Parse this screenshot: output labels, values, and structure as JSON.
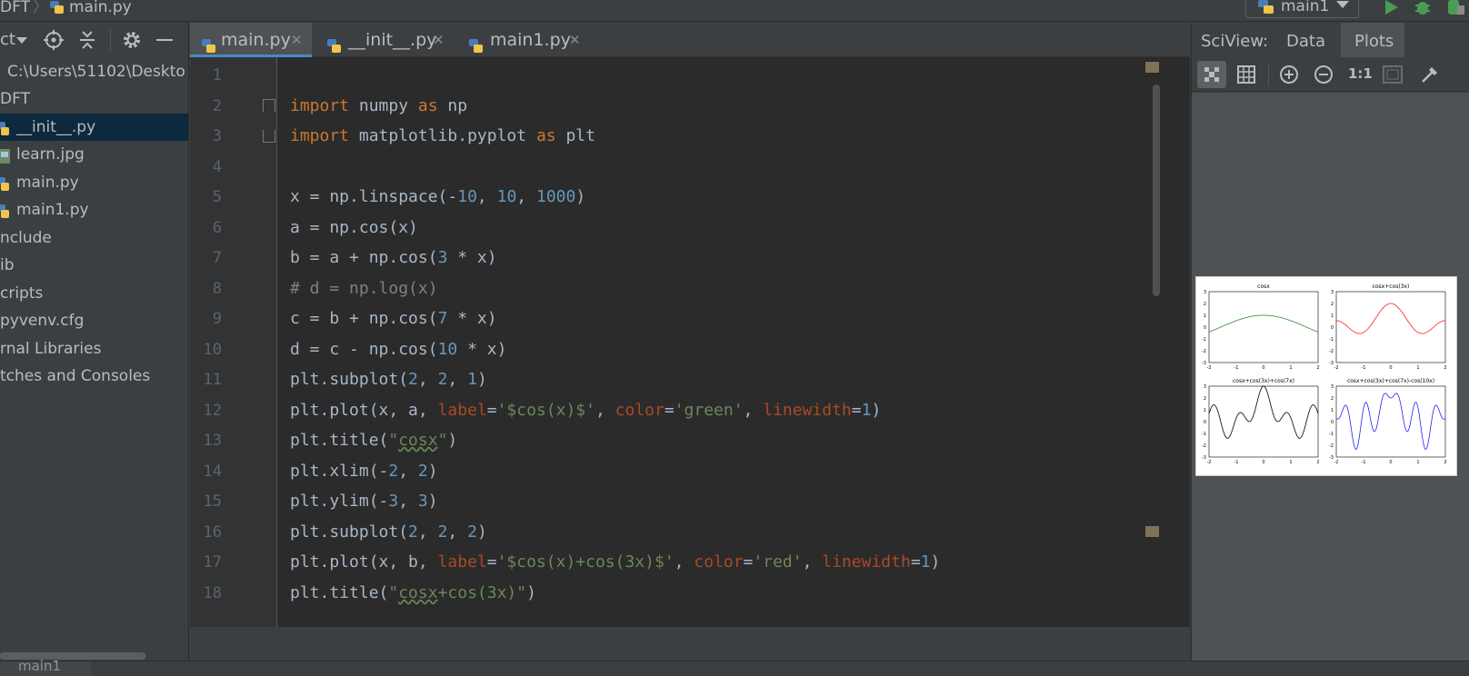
{
  "breadcrumb": {
    "project": "DFT",
    "file": "main.py"
  },
  "run_config": {
    "name": "main1"
  },
  "project_panel": {
    "header_label": "ct",
    "path": "C:\\Users\\51102\\Deskto",
    "items": [
      {
        "label": "DFT"
      },
      {
        "label": "__init__.py"
      },
      {
        "label": "learn.jpg"
      },
      {
        "label": "main.py"
      },
      {
        "label": "main1.py"
      },
      {
        "label": "nclude"
      },
      {
        "label": "ib"
      },
      {
        "label": "cripts"
      },
      {
        "label": "pyvenv.cfg"
      },
      {
        "label": "rnal Libraries"
      },
      {
        "label": "tches and Consoles"
      }
    ]
  },
  "tabs": [
    {
      "label": "main.py"
    },
    {
      "label": "__init__.py"
    },
    {
      "label": "main1.py"
    }
  ],
  "line_numbers": [
    "1",
    "2",
    "3",
    "4",
    "5",
    "6",
    "7",
    "8",
    "9",
    "10",
    "11",
    "12",
    "13",
    "14",
    "15",
    "16",
    "17",
    "18"
  ],
  "sciview": {
    "label": "SciView:",
    "tab_data": "Data",
    "tab_plots": "Plots",
    "one_to_one": "1:1"
  },
  "plot_titles": [
    "cosx",
    "cosx+cos(3x)",
    "cosx+cos(3x)+cos(7x)",
    "cosx+cos(3x)+cos(7x)-cos(10x)"
  ],
  "plot_colors": [
    "#2e8b2e",
    "#ff2020",
    "#000000",
    "#2020ff"
  ],
  "plot_ticks_x": [
    "-2",
    "-1",
    "0",
    "1",
    "2"
  ],
  "plot_ticks_y": [
    "3",
    "2",
    "1",
    "0",
    "-1",
    "-2",
    "-3"
  ],
  "bottom": {
    "tab": "main1"
  }
}
